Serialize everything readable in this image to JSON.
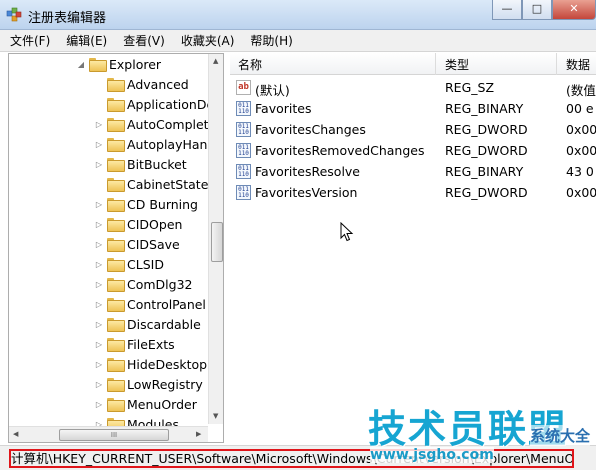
{
  "window": {
    "title": "注册表编辑器",
    "buttons": {
      "minimize": "—",
      "maximize": "□",
      "close": "✕"
    }
  },
  "menu": [
    "文件(F)",
    "编辑(E)",
    "查看(V)",
    "收藏夹(A)",
    "帮助(H)"
  ],
  "tree": {
    "parent": "Explorer",
    "items": [
      "Advanced",
      "ApplicationDe",
      "AutoComplete",
      "AutoplayHanc",
      "BitBucket",
      "CabinetState",
      "CD Burning",
      "CIDOpen",
      "CIDSave",
      "CLSID",
      "ComDlg32",
      "ControlPanel",
      "Discardable",
      "FileExts",
      "HideDesktopI",
      "LowRegistry",
      "MenuOrder",
      "Modules"
    ],
    "hscroll_grip": "III"
  },
  "list": {
    "columns": [
      "名称",
      "类型",
      "数据"
    ],
    "rows": [
      {
        "icon": "string-value-icon",
        "name": "(默认)",
        "type": "REG_SZ",
        "data": "(数值"
      },
      {
        "icon": "binary-value-icon",
        "name": "Favorites",
        "type": "REG_BINARY",
        "data": "00 e"
      },
      {
        "icon": "binary-value-icon",
        "name": "FavoritesChanges",
        "type": "REG_DWORD",
        "data": "0x00"
      },
      {
        "icon": "binary-value-icon",
        "name": "FavoritesRemovedChanges",
        "type": "REG_DWORD",
        "data": "0x00"
      },
      {
        "icon": "binary-value-icon",
        "name": "FavoritesResolve",
        "type": "REG_BINARY",
        "data": "43 0"
      },
      {
        "icon": "binary-value-icon",
        "name": "FavoritesVersion",
        "type": "REG_DWORD",
        "data": "0x00"
      }
    ],
    "ab_label": "ab",
    "bin_label": "011\n110"
  },
  "status": {
    "path": "计算机\\HKEY_CURRENT_USER\\Software\\Microsoft\\Windows\\CurrentVersion\\Explorer\\MenuOrder"
  },
  "watermark": {
    "title": "技术员联盟",
    "url": "www.jsgho.com",
    "side": "系统大全"
  }
}
